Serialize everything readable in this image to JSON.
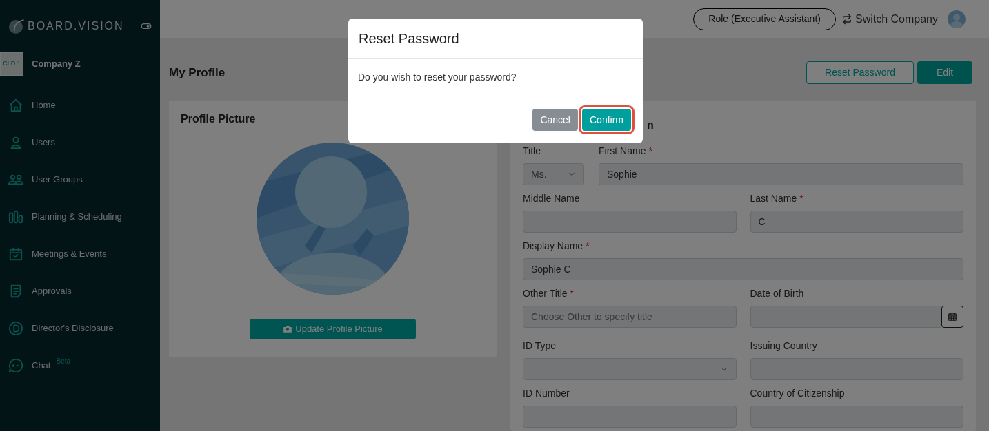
{
  "sidebar": {
    "brand": "BOARD.VISION",
    "company": {
      "logo_text": "CLD 1",
      "name": "Company Z"
    },
    "items": [
      {
        "label": "Home"
      },
      {
        "label": "Users"
      },
      {
        "label": "User Groups"
      },
      {
        "label": "Planning & Scheduling"
      },
      {
        "label": "Meetings & Events"
      },
      {
        "label": "Approvals"
      },
      {
        "label": "Director's Disclosure"
      },
      {
        "label": "Chat",
        "badge": "Beta"
      }
    ]
  },
  "header": {
    "role": "Role (Executive Assistant)",
    "switch_company": "Switch Company"
  },
  "page": {
    "title": "My Profile",
    "actions": [
      {
        "label": "Reset Password",
        "kind": "outline"
      },
      {
        "label": "Edit",
        "kind": "solid"
      }
    ]
  },
  "profile_card": {
    "title": "Profile Picture",
    "button": "Update Profile Picture"
  },
  "details_card": {
    "title_visible": "n",
    "rows": [
      [
        {
          "label": "Title",
          "kind": "compact-select",
          "value": "Ms."
        },
        {
          "label": "First Name",
          "required_mark": "*",
          "kind": "text",
          "value": "Sophie"
        }
      ],
      [
        {
          "label": "Middle Name",
          "kind": "text"
        },
        {
          "label": "Last Name",
          "required_mark": "*",
          "kind": "text",
          "value": "C"
        }
      ],
      [
        {
          "label": "Display Name",
          "required_mark": "*",
          "kind": "text",
          "value": "Sophie C"
        }
      ],
      [
        {
          "label": "Other Title",
          "required_mark": "*",
          "kind": "text",
          "placeholder": "Choose Other to specify title"
        },
        {
          "label": "Date of Birth",
          "kind": "date"
        }
      ],
      [
        {
          "label": "ID Type",
          "kind": "select"
        },
        {
          "label": "Issuing Country",
          "kind": "text"
        }
      ],
      [
        {
          "label": "ID Number",
          "kind": "text"
        },
        {
          "label": "Country of Citizenship",
          "kind": "text"
        }
      ]
    ]
  },
  "modal": {
    "title": "Reset Password",
    "message": "Do you wish to reset your password?",
    "buttons": [
      {
        "label": "Cancel",
        "kind": "secondary",
        "highlighted": false
      },
      {
        "label": "Confirm",
        "kind": "primary",
        "highlighted": true
      }
    ]
  }
}
